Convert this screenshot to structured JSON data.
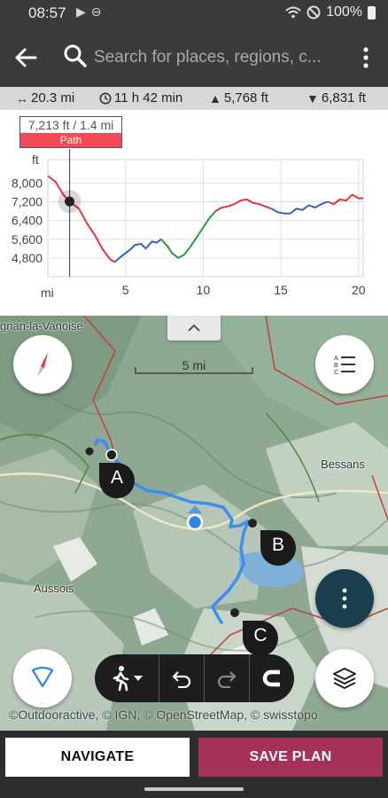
{
  "status_bar": {
    "time": "08:57",
    "battery": "100%",
    "icons": [
      "play-icon",
      "dnd-icon",
      "wifi-icon",
      "blocked-icon",
      "battery-icon"
    ]
  },
  "app_bar": {
    "search_placeholder": "Search for places, regions, c...",
    "icons": [
      "back-arrow-icon",
      "search-icon",
      "more-vertical-icon"
    ]
  },
  "stats": {
    "distance": "20.3 mi",
    "duration": "11 h 42 min",
    "ascent": "5,768 ft",
    "descent": "6,831 ft"
  },
  "chart_data": {
    "type": "line",
    "xlabel": "mi",
    "ylabel": "ft",
    "xlim": [
      0,
      20.3
    ],
    "ylim": [
      4000,
      9000
    ],
    "x_ticks": [
      5,
      10,
      15,
      20
    ],
    "y_ticks": [
      4800,
      5600,
      6400,
      7200,
      8000
    ],
    "x_tick_labels": [
      "5",
      "10",
      "15",
      "20"
    ],
    "y_tick_labels": [
      "4,800",
      "5,600",
      "6,400",
      "7,200",
      "8,000"
    ],
    "tooltip": {
      "value": "7,213 ft / 1.4 mi",
      "label": "Path",
      "x": 1.4,
      "y": 7213
    },
    "series": [
      {
        "values": [
          [
            0.0,
            8300
          ],
          [
            0.5,
            8050
          ],
          [
            1.0,
            7500
          ],
          [
            1.4,
            7213
          ],
          [
            2.0,
            6900
          ],
          [
            2.5,
            6300
          ],
          [
            3.0,
            5800
          ],
          [
            3.5,
            5200
          ],
          [
            4.0,
            4750
          ],
          [
            4.3,
            4620
          ],
          [
            4.7,
            4850
          ],
          [
            5.0,
            5000
          ],
          [
            5.3,
            5150
          ],
          [
            5.6,
            5350
          ],
          [
            6.0,
            5400
          ],
          [
            6.3,
            5200
          ],
          [
            6.7,
            5500
          ],
          [
            7.0,
            5450
          ],
          [
            7.3,
            5600
          ],
          [
            7.7,
            5300
          ],
          [
            8.0,
            5000
          ],
          [
            8.4,
            4800
          ],
          [
            8.8,
            4950
          ],
          [
            9.2,
            5300
          ],
          [
            9.6,
            5700
          ],
          [
            10.0,
            6100
          ],
          [
            10.4,
            6500
          ],
          [
            10.8,
            6800
          ],
          [
            11.2,
            6950
          ],
          [
            11.6,
            7000
          ],
          [
            12.0,
            7100
          ],
          [
            12.4,
            7250
          ],
          [
            12.8,
            7300
          ],
          [
            13.2,
            7150
          ],
          [
            13.6,
            7100
          ],
          [
            14.0,
            7000
          ],
          [
            14.4,
            6900
          ],
          [
            14.8,
            6750
          ],
          [
            15.2,
            6700
          ],
          [
            15.6,
            6700
          ],
          [
            16.0,
            6900
          ],
          [
            16.4,
            6850
          ],
          [
            16.8,
            7050
          ],
          [
            17.2,
            6950
          ],
          [
            17.6,
            7100
          ],
          [
            18.0,
            7200
          ],
          [
            18.4,
            7100
          ],
          [
            18.8,
            7300
          ],
          [
            19.2,
            7250
          ],
          [
            19.6,
            7500
          ],
          [
            20.0,
            7350
          ],
          [
            20.3,
            7350
          ]
        ],
        "segment_colors": [
          "#e8313c",
          "#2f63c4",
          "#2c9a3c",
          "#e8313c",
          "#2f63c4",
          "#e8313c"
        ]
      }
    ],
    "grid": true
  },
  "map": {
    "scale_label": "5 mi",
    "places": [
      "gnan-la-Vanoise",
      "Bessans",
      "Aussois"
    ],
    "waypoints": [
      "A",
      "B",
      "C"
    ],
    "route_color": "#3b8ff0",
    "attribution": "©Outdooractive, © IGN, © OpenStreetMap, © swisstopo",
    "buttons": [
      "compass-icon",
      "list-icon",
      "more-vertical-icon",
      "view-cone-icon",
      "layers-icon"
    ],
    "toolbar": [
      "walking-icon",
      "chevron-down-icon",
      "undo-icon",
      "redo-icon",
      "magnet-icon"
    ]
  },
  "actions": {
    "navigate": "NAVIGATE",
    "save_plan": "SAVE PLAN"
  }
}
